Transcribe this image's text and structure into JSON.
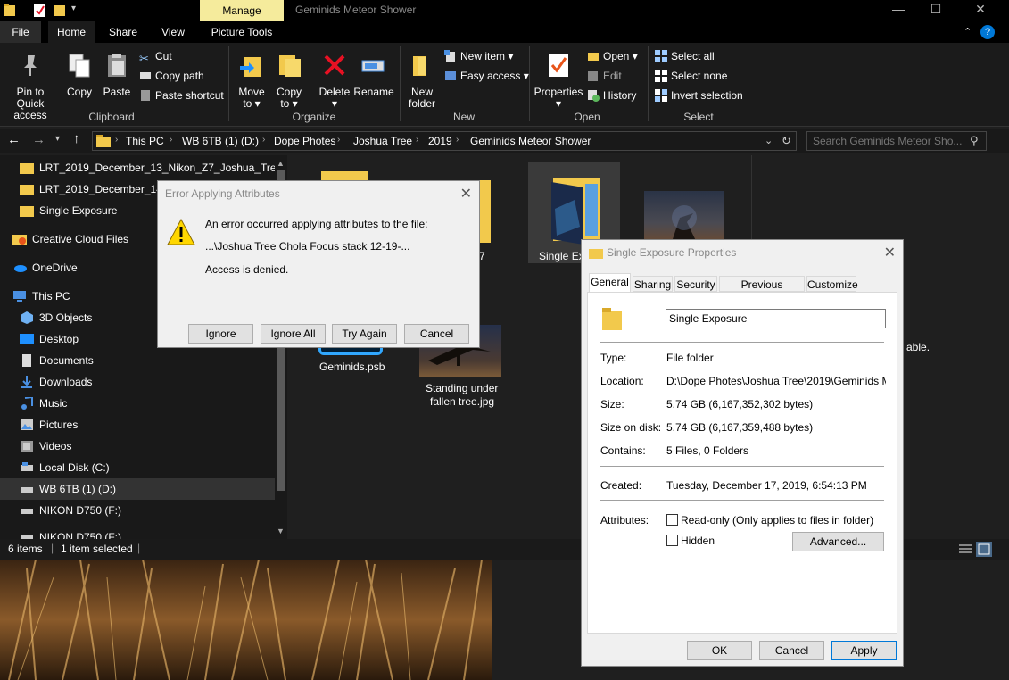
{
  "window": {
    "title": "Geminids Meteor Shower",
    "context_tab": "Manage",
    "controls": {
      "minimize": "—",
      "maximize": "☐",
      "close": "✕"
    }
  },
  "ribbon_tabs": [
    "File",
    "Home",
    "Share",
    "View",
    "Picture Tools"
  ],
  "ribbon": {
    "clipboard": {
      "label": "Clipboard",
      "pin_line1": "Pin to Quick",
      "pin_line2": "access",
      "copy": "Copy",
      "paste": "Paste",
      "cut": "Cut",
      "copy_path": "Copy path",
      "paste_shortcut": "Paste shortcut"
    },
    "organize": {
      "label": "Organize",
      "move_line1": "Move",
      "move_line2": "to ▾",
      "copy_line1": "Copy",
      "copy_line2": "to ▾",
      "delete_line1": "Delete",
      "delete_line2": "▾",
      "rename": "Rename"
    },
    "new": {
      "label": "New",
      "new_folder_line1": "New",
      "new_folder_line2": "folder",
      "new_item": "New item ▾",
      "easy_access": "Easy access ▾"
    },
    "open": {
      "label": "Open",
      "properties": "Properties",
      "properties_arrow": "▾",
      "open": "Open ▾",
      "edit": "Edit",
      "history": "History"
    },
    "select": {
      "label": "Select",
      "select_all": "Select all",
      "select_none": "Select none",
      "invert": "Invert selection"
    }
  },
  "breadcrumb": [
    "This PC",
    "WB 6TB (1) (D:)",
    "Dope Photes",
    "Joshua Tree",
    "2019",
    "Geminids Meteor Shower"
  ],
  "search": {
    "placeholder": "Search Geminids Meteor Sho..."
  },
  "nav_pane": {
    "items": [
      "LRT_2019_December_13_Nikon_Z7_Joshua_Tree_T",
      "LRT_2019_December_14_",
      "Single Exposure",
      "Creative Cloud Files",
      "OneDrive",
      "This PC",
      "3D Objects",
      "Desktop",
      "Documents",
      "Downloads",
      "Music",
      "Pictures",
      "Videos",
      "Local Disk (C:)",
      "WB 6TB (1) (D:)",
      "NIKON D750  (F:)",
      "NIKON D750  (F:)"
    ]
  },
  "files": {
    "partial_7": "7",
    "single_exposure": "Single Ex",
    "psb_badge": "PSB",
    "psb_name": "Geminids.psb",
    "photo_line1": "Standing under",
    "photo_line2": "fallen tree.jpg"
  },
  "details_text": "able.",
  "status": {
    "count": "6 items",
    "selected": "1 item selected"
  },
  "error_dialog": {
    "title": "Error Applying Attributes",
    "message": "An error occurred applying attributes to the file:",
    "path": "...\\Joshua Tree Chola Focus stack 12-19-...",
    "detail": "Access is denied.",
    "buttons": [
      "Ignore",
      "Ignore All",
      "Try Again",
      "Cancel"
    ]
  },
  "props_dialog": {
    "title": "Single Exposure Properties",
    "tabs": [
      "General",
      "Sharing",
      "Security",
      "Previous Versions",
      "Customize"
    ],
    "name_value": "Single Exposure",
    "type_label": "Type:",
    "type_value": "File folder",
    "location_label": "Location:",
    "location_value": "D:\\Dope Photes\\Joshua Tree\\2019\\Geminids Mete",
    "size_label": "Size:",
    "size_value": "5.74 GB (6,167,352,302 bytes)",
    "size_disk_label": "Size on disk:",
    "size_disk_value": "5.74 GB (6,167,359,488 bytes)",
    "contains_label": "Contains:",
    "contains_value": "5 Files, 0 Folders",
    "created_label": "Created:",
    "created_value": "Tuesday, December 17, 2019, 6:54:13 PM",
    "attributes_label": "Attributes:",
    "readonly": "Read-only (Only applies to files in folder)",
    "hidden": "Hidden",
    "advanced": "Advanced...",
    "ok": "OK",
    "cancel": "Cancel",
    "apply": "Apply"
  },
  "colors": {
    "folder": "#f2c94c",
    "accent": "#0078d7",
    "manage_tab": "#f5eb9c",
    "error_red": "#e81123"
  }
}
